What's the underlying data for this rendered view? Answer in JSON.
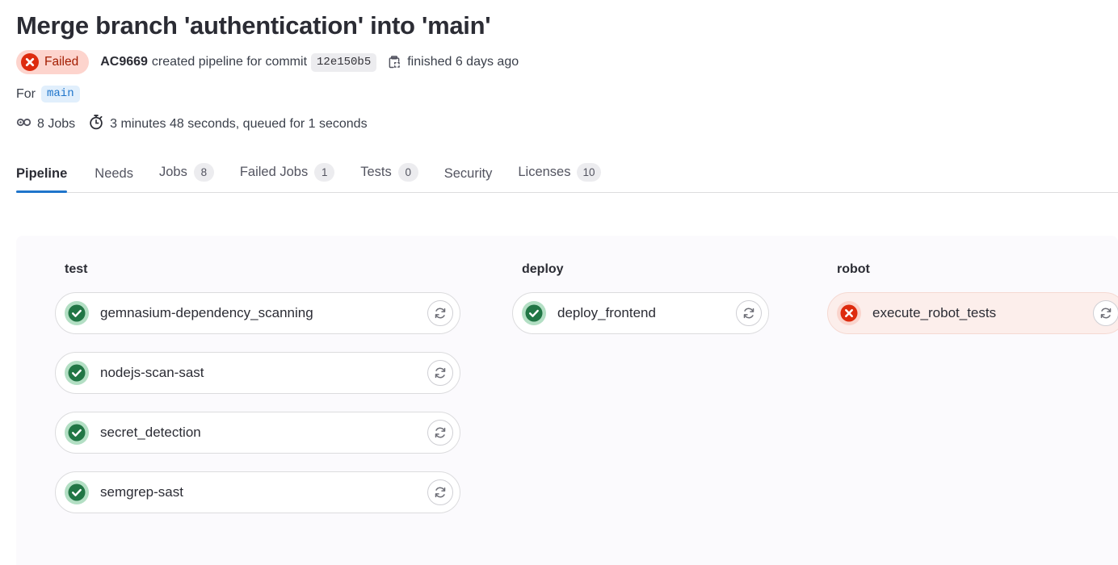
{
  "header": {
    "title": "Merge branch 'authentication' into 'main'",
    "status_label": "Failed",
    "status_color": "#dd2b0e",
    "status_bg": "#fdd4cd",
    "author": "AC9669",
    "created_text": "created pipeline for commit",
    "commit_sha": "12e150b5",
    "copy_icon": "clipboard-copy-icon",
    "finished_text": "finished 6 days ago",
    "for_label": "For",
    "ref_name": "main",
    "jobs_icon": "pipeline-jobs-icon",
    "jobs_text": "8 Jobs",
    "duration_icon": "stopwatch-icon",
    "duration_text": "3 minutes 48 seconds, queued for 1 seconds"
  },
  "tabs": [
    {
      "label": "Pipeline",
      "badge": null,
      "active": true
    },
    {
      "label": "Needs",
      "badge": null,
      "active": false
    },
    {
      "label": "Jobs",
      "badge": "8",
      "active": false
    },
    {
      "label": "Failed Jobs",
      "badge": "1",
      "active": false
    },
    {
      "label": "Tests",
      "badge": "0",
      "active": false
    },
    {
      "label": "Security",
      "badge": null,
      "active": false
    },
    {
      "label": "Licenses",
      "badge": "10",
      "active": false
    }
  ],
  "pipeline": {
    "retry_icon": "retry-icon",
    "success_icon": "status-success-icon",
    "failed_icon": "status-failed-icon",
    "success_color": "#217645",
    "success_halo": "#b3dfc4",
    "failed_color": "#dd2b0e",
    "failed_halo": "#fad4cc",
    "stages": [
      {
        "name": "test",
        "jobs": [
          {
            "name": "gemnasium-dependency_scanning",
            "status": "success"
          },
          {
            "name": "nodejs-scan-sast",
            "status": "success"
          },
          {
            "name": "secret_detection",
            "status": "success"
          },
          {
            "name": "semgrep-sast",
            "status": "success"
          }
        ]
      },
      {
        "name": "deploy",
        "jobs": [
          {
            "name": "deploy_frontend",
            "status": "success"
          }
        ]
      },
      {
        "name": "robot",
        "jobs": [
          {
            "name": "execute_robot_tests",
            "status": "failed"
          }
        ]
      }
    ]
  }
}
